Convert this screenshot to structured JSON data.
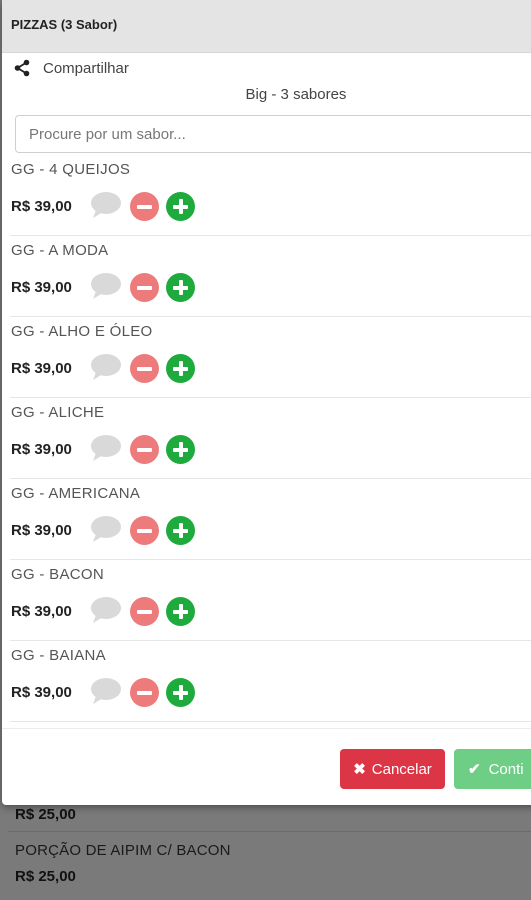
{
  "background": {
    "items": [
      {
        "name": "",
        "price": "R$ 25,00"
      },
      {
        "name": "PORÇÃO DE AIPIM C/ BACON",
        "price": "R$ 25,00"
      }
    ]
  },
  "modal": {
    "title": "PIZZAS (3 Sabor)",
    "share_label": "Compartilhar",
    "subtitle": "Big - 3 sabores",
    "search_placeholder": "Procure por um sabor...",
    "flavors": [
      {
        "name": "GG - 4 QUEIJOS",
        "price": "R$ 39,00"
      },
      {
        "name": "GG - A MODA",
        "price": "R$ 39,00"
      },
      {
        "name": "GG - ALHO E ÓLEO",
        "price": "R$ 39,00"
      },
      {
        "name": "GG - ALICHE",
        "price": "R$ 39,00"
      },
      {
        "name": "GG - AMERICANA",
        "price": "R$ 39,00"
      },
      {
        "name": "GG - BACON",
        "price": "R$ 39,00"
      },
      {
        "name": "GG - BAIANA",
        "price": "R$ 39,00"
      }
    ],
    "cancel_label": "Cancelar",
    "continue_label": "Conti"
  },
  "icons": {
    "share": "share-icon",
    "comment": "comment-icon",
    "minus": "minus-circle-icon",
    "plus": "plus-circle-icon",
    "cancel": "x-icon",
    "continue": "check-icon"
  },
  "colors": {
    "minus": "#ee7b7b",
    "plus": "#1eaa3c",
    "cancel": "#dc3545",
    "continue": "#6fce85",
    "header": "#e4e4e4"
  }
}
